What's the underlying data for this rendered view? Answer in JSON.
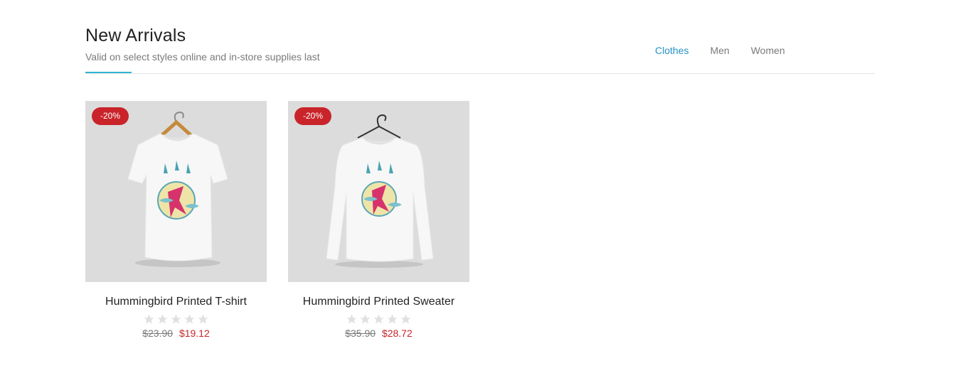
{
  "header": {
    "title": "New Arrivals",
    "subtitle": "Valid on select styles online and in-store supplies last"
  },
  "tabs": [
    {
      "label": "Clothes",
      "active": true
    },
    {
      "label": "Men",
      "active": false
    },
    {
      "label": "Women",
      "active": false
    }
  ],
  "products": [
    {
      "name": "Hummingbird Printed T-shirt",
      "badge": "-20%",
      "old_price": "$23.90",
      "price": "$19.12",
      "rating": 0,
      "image_icon": "tshirt-image"
    },
    {
      "name": "Hummingbird Printed Sweater",
      "badge": "-20%",
      "old_price": "$35.90",
      "price": "$28.72",
      "rating": 0,
      "image_icon": "sweater-image"
    }
  ],
  "colors": {
    "accent": "#2fb5d2",
    "active_tab": "#2592c4",
    "sale": "#c9242a",
    "star_empty": "#e0e0e0",
    "thumb_bg": "#dcdcdc"
  }
}
